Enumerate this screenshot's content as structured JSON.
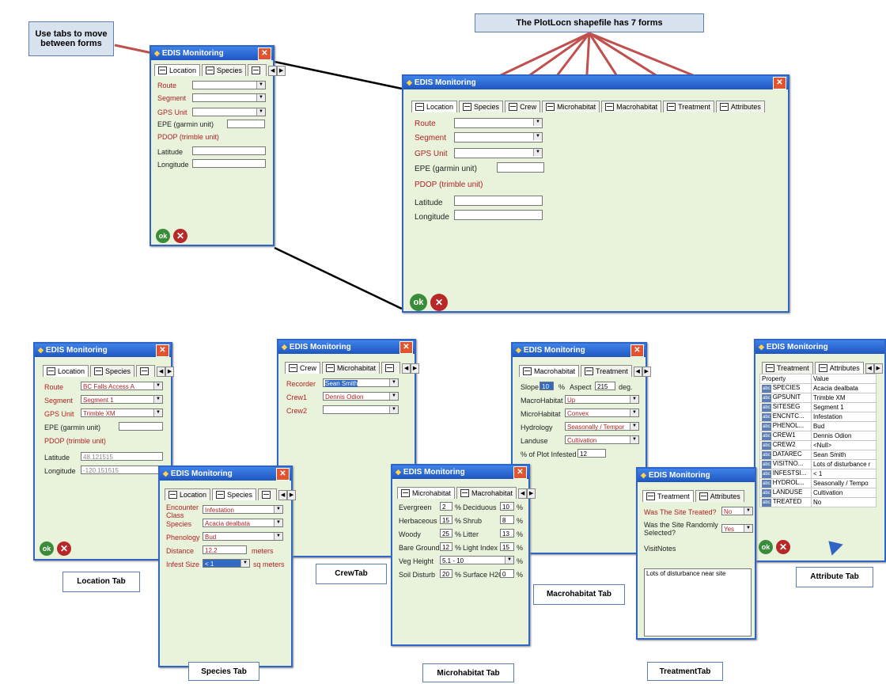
{
  "callouts": {
    "use_tabs": "Use tabs to move between forms",
    "seven_forms": "The PlotLocn shapefile has 7 forms"
  },
  "window_title": "EDIS Monitoring",
  "tab_labels": [
    "Location",
    "Species",
    "Crew",
    "Microhabitat",
    "Macrohabitat",
    "Treatment",
    "Attributes"
  ],
  "ok": "ok",
  "location": {
    "route": "Route",
    "segment": "Segment",
    "gps": "GPS Unit",
    "epe": "EPE (garmin unit)",
    "pdop": "PDOP (trimble unit)",
    "lat": "Latitude",
    "lon": "Longitude",
    "route_val": "BC Falls Access A",
    "segment_val": "Segment 1",
    "gps_val": "Trimble XM",
    "lat_val": "48.121515",
    "lon_val": "-120.151515"
  },
  "species": {
    "enc": "Encounter Class",
    "species": "Species",
    "phen": "Phenology",
    "dist": "Distance",
    "infest": "Infest Size",
    "enc_val": "Infestation",
    "species_val": "Acacia dealbata",
    "phen_val": "Bud",
    "dist_val": "12.2",
    "dist_unit": "meters",
    "infest_val": "< 1",
    "infest_unit": "sq meters"
  },
  "crew": {
    "recorder": "Recorder",
    "crew1": "Crew1",
    "crew2": "Crew2",
    "recorder_val": "Sean Smith",
    "crew1_val": "Dennis Odion"
  },
  "micro": {
    "evergreen": "Evergreen",
    "evergreen_val": "2",
    "deciduous": "Deciduous",
    "deciduous_val": "10",
    "herb": "Herbaceous",
    "herb_val": "15",
    "shrub": "Shrub",
    "shrub_val": "8",
    "woody": "Woody",
    "woody_val": "25",
    "litter": "Litter",
    "litter_val": "13",
    "bare": "Bare Ground",
    "bare_val": "12",
    "light": "Light Index",
    "light_val": "15",
    "veg": "Veg Height",
    "veg_val": "5.1 - 10",
    "soil": "Soil Disturb",
    "soil_val": "20",
    "surf": "Surface H2O",
    "surf_val": "0",
    "pct": "%"
  },
  "macro": {
    "slope": "Slope",
    "slope_val": "10",
    "aspect": "Aspect",
    "aspect_val": "215",
    "deg": "deg.",
    "pct": "%",
    "mh": "MacroHabitat",
    "mh_val": "Up",
    "mih": "MicroHabitat",
    "mih_val": "Convex",
    "hyd": "Hydrology",
    "hyd_val": "Seasonally / Tempor",
    "land": "Landuse",
    "land_val": "Cultivation",
    "pct_inf": "% of Plot Infested",
    "pct_inf_val": "12"
  },
  "treat": {
    "treated": "Was The Site Treated?",
    "treated_val": "No",
    "random": "Was the Site Randomly Selected?",
    "random_val": "Yes",
    "notes": "VisitNotes",
    "notes_val": "Lots of disturbance near site"
  },
  "attr": {
    "h_prop": "Property",
    "h_val": "Value",
    "rows": [
      {
        "p": "SPECIES",
        "v": "Acacia dealbata"
      },
      {
        "p": "GPSUNIT",
        "v": "Trimble XM"
      },
      {
        "p": "SITESEG",
        "v": "Segment 1"
      },
      {
        "p": "ENCNTC...",
        "v": "Infestation"
      },
      {
        "p": "PHENOL...",
        "v": "Bud"
      },
      {
        "p": "CREW1",
        "v": "Dennis Odion"
      },
      {
        "p": "CREW2",
        "v": "<Null>"
      },
      {
        "p": "DATAREC",
        "v": "Sean Smith"
      },
      {
        "p": "VISITNO...",
        "v": "Lots of disturbance r"
      },
      {
        "p": "INFESTSI...",
        "v": "< 1"
      },
      {
        "p": "HYDROL...",
        "v": "Seasonally / Tempo"
      },
      {
        "p": "LANDUSE",
        "v": "Cultivation"
      },
      {
        "p": "TREATED",
        "v": "No"
      }
    ]
  },
  "captions": {
    "location": "Location Tab",
    "species": "Species Tab",
    "crew": "CrewTab",
    "micro": "Microhabitat Tab",
    "macro": "Macrohabitat Tab",
    "treat": "TreatmentTab",
    "attr": "Attribute Tab"
  }
}
